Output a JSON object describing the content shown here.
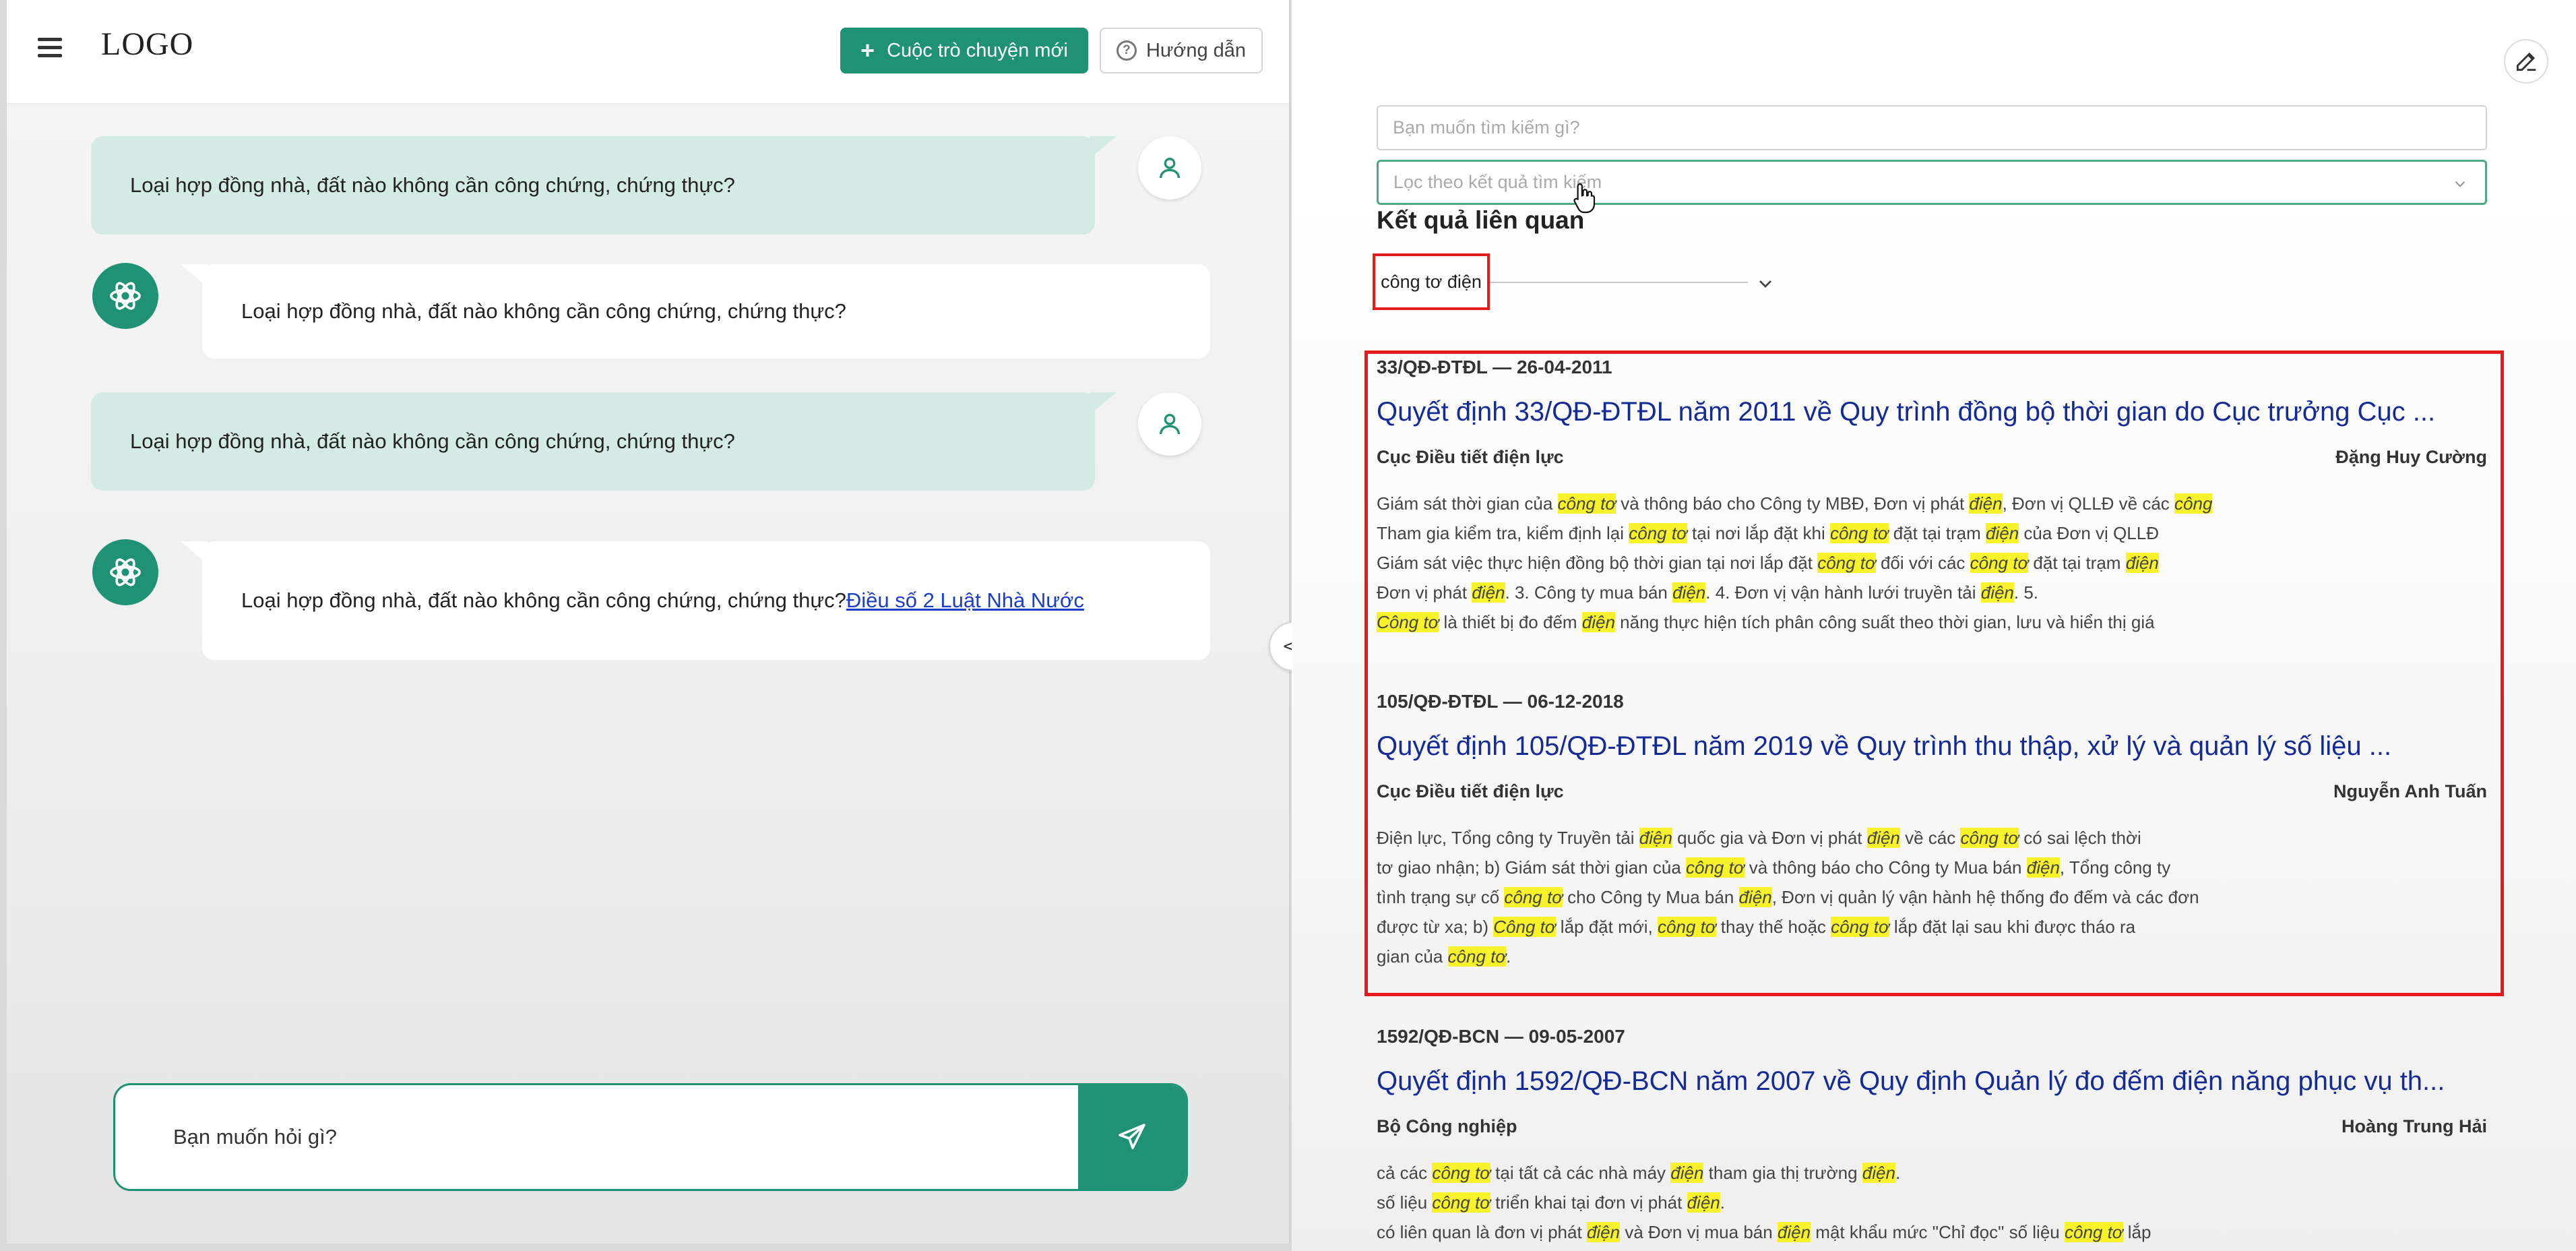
{
  "header": {
    "logo": "LOGO",
    "new_chat_label": "Cuộc trò chuyện mới",
    "help_label": "Hướng dẫn"
  },
  "chat": {
    "messages": [
      {
        "role": "user",
        "text": "Loại hợp đồng nhà, đất nào không cần công chứng, chứng thực?"
      },
      {
        "role": "bot",
        "text": "Loại hợp đồng nhà, đất nào không cần công chứng, chứng thực?"
      },
      {
        "role": "user",
        "text": "Loại hợp đồng nhà, đất nào không cần công chứng, chứng thực?"
      },
      {
        "role": "bot",
        "text": "Loại hợp đồng nhà, đất nào không cần công chứng, chứng thực?",
        "link": "Điều số 2 Luật Nhà Nước"
      }
    ],
    "input_placeholder": "Bạn muốn hỏi gì?"
  },
  "toggle_glyph": "<>",
  "search": {
    "placeholder": "Bạn muốn tìm kiếm gì?",
    "filter_placeholder": "Lọc theo kết quả tìm kiếm",
    "results_title": "Kết quả liên quan",
    "tag": "công tơ điện"
  },
  "results": [
    {
      "code": "33/QĐ-ĐTĐL — 26-04-2011",
      "title": "Quyết định 33/QĐ-ĐTĐL năm 2011 về Quy trình đồng bộ thời gian do Cục trưởng Cục ...",
      "agency": "Cục Điều tiết điện lực",
      "signer": "Đặng Huy Cường",
      "lines": [
        "Giám sát thời gian của [công tơ] và thông báo cho Công ty MBĐ, Đơn vị phát [điện], Đơn vị QLLĐ về các [công]",
        "Tham gia kiểm tra, kiểm định lại [công tơ] tại nơi lắp đặt khi [công tơ] đặt tại trạm [điện] của Đơn vị QLLĐ",
        "Giám sát việc thực hiện đồng bộ thời gian tại nơi lắp đặt [công tơ] đối với các [công tơ] đặt tại trạm [điện]",
        "Đơn vị phát [điện]. 3. Công ty mua bán [điện]. 4. Đơn vị vận hành lưới truyền tải [điện]. 5.",
        "[Công tơ] là thiết bị đo đếm [điện] năng thực hiện tích phân công suất theo thời gian, lưu và hiển thị giá"
      ]
    },
    {
      "code": "105/QĐ-ĐTĐL — 06-12-2018",
      "title": "Quyết định 105/QĐ-ĐTĐL năm 2019 về Quy trình thu thập, xử lý và quản lý số liệu ...",
      "agency": "Cục Điều tiết điện lực",
      "signer": "Nguyễn Anh Tuấn",
      "lines": [
        "Điện lực, Tổng công ty Truyền tải [điện] quốc gia và Đơn vị phát [điện] về các [công tơ] có sai lệch thời",
        "tơ giao nhận; b) Giám sát thời gian của [công tơ] và thông báo cho Công ty Mua bán [điện], Tổng công ty",
        "tình trạng sự cố [công tơ] cho Công ty Mua bán [điện], Đơn vị quản lý vận hành hệ thống đo đếm và các đơn",
        "được từ xa; b) [Công tơ] lắp đặt mới, [công tơ] thay thế hoặc [công tơ] lắp đặt lại sau khi được tháo ra",
        "gian của [công tơ]."
      ]
    },
    {
      "code": "1592/QĐ-BCN — 09-05-2007",
      "title": "Quyết định 1592/QĐ-BCN năm 2007 về Quy định Quản lý đo đếm điện năng phục vụ th...",
      "agency": "Bộ Công nghiệp",
      "signer": "Hoàng Trung Hải",
      "lines": [
        "cả các [công tơ] tại tất cả các nhà máy [điện] tham gia thị trường [điện].",
        "số liệu [công tơ] triển khai tại đơn vị phát [điện].",
        "có liên quan là đơn vị phát [điện] và Đơn vị mua bán [điện] mật khẩu mức \"Chỉ đọc\" số liệu [công tơ] lắp"
      ]
    }
  ],
  "colors": {
    "accent": "#1f9274",
    "user_bubble": "#d4ebe5",
    "highlight": "#f8f22a",
    "annotation_red": "#e41b1b",
    "title_link": "#142a94"
  }
}
